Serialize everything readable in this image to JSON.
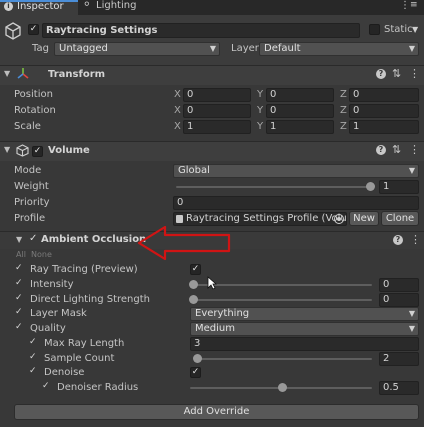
{
  "tabs": [
    {
      "label": "Inspector",
      "icon": "info-icon"
    },
    {
      "label": "Lighting",
      "icon": "lightbulb-icon"
    }
  ],
  "object": {
    "name": "Raytracing Settings",
    "static_label": "Static",
    "tag_label": "Tag",
    "tag_value": "Untagged",
    "layer_label": "Layer",
    "layer_value": "Default"
  },
  "transform": {
    "title": "Transform",
    "rows": [
      {
        "label": "Position",
        "x": "0",
        "y": "0",
        "z": "0"
      },
      {
        "label": "Rotation",
        "x": "0",
        "y": "0",
        "z": "0"
      },
      {
        "label": "Scale",
        "x": "1",
        "y": "1",
        "z": "1"
      }
    ],
    "axis_x": "X",
    "axis_y": "Y",
    "axis_z": "Z"
  },
  "volume": {
    "title": "Volume",
    "mode_label": "Mode",
    "mode_value": "Global",
    "weight_label": "Weight",
    "weight_value": "1",
    "weight_level": 1.0,
    "priority_label": "Priority",
    "priority_value": "0",
    "profile_label": "Profile",
    "profile_value": "Raytracing Settings Profile (Volu",
    "new_button": "New",
    "clone_button": "Clone"
  },
  "ao": {
    "title": "Ambient Occlusion",
    "all_label": "All",
    "none_label": "None",
    "ray_tracing_label": "Ray Tracing (Preview)",
    "intensity_label": "Intensity",
    "intensity_value": "0",
    "intensity_level": 0.0,
    "dls_label": "Direct Lighting Strength",
    "dls_value": "0",
    "dls_level": 0.0,
    "layer_mask_label": "Layer Mask",
    "layer_mask_value": "Everything",
    "quality_label": "Quality",
    "quality_value": "Medium",
    "max_ray_label": "Max Ray Length",
    "max_ray_value": "3",
    "sample_label": "Sample Count",
    "sample_value": "2",
    "sample_level": 0.0,
    "denoise_label": "Denoise",
    "radius_label": "Denoiser Radius",
    "radius_value": "0.5",
    "radius_level": 0.5
  },
  "add_override": "Add Override",
  "colors": {
    "background": "#383838",
    "annotation": "#d01414"
  }
}
